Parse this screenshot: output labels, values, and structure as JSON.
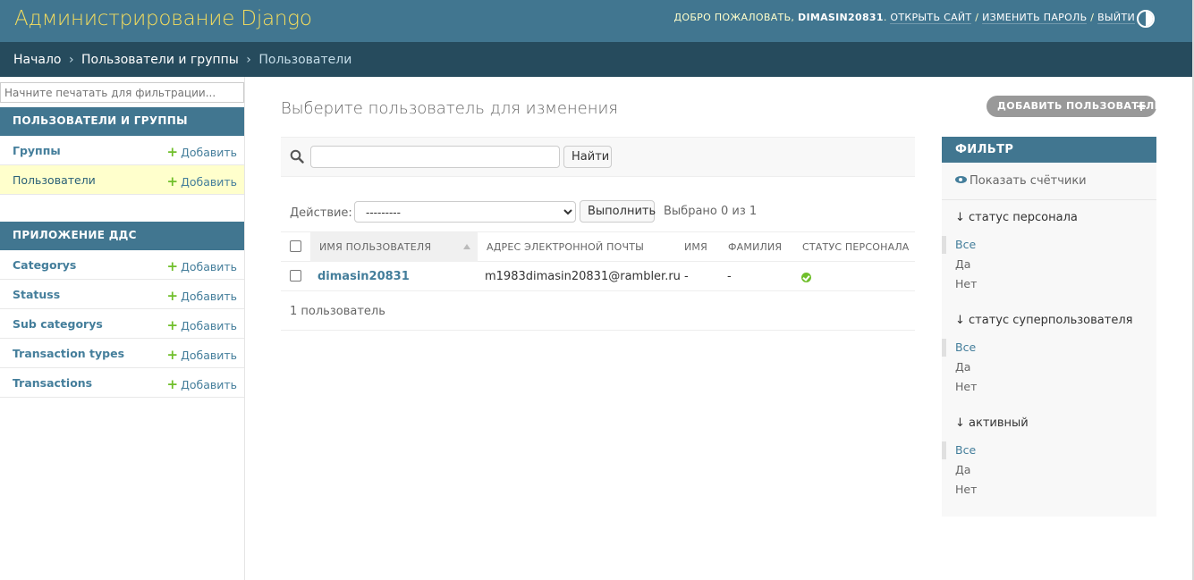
{
  "header": {
    "branding": "Администрирование Django",
    "welcome": "Добро пожаловать,",
    "username": "DIMASIN20831",
    "view_site": "Открыть сайт",
    "change_password": "Изменить пароль",
    "logout": "Выйти",
    "separator": "/",
    "theme_toggle_icon": "contrast-icon"
  },
  "breadcrumbs": {
    "home": "Начало",
    "app": "Пользователи и группы",
    "current": "Пользователи",
    "separator": "›"
  },
  "sidebar": {
    "filter_placeholder": "Начните печатать для фильтрации...",
    "modules": [
      {
        "caption": "Пользователи и группы",
        "models": [
          {
            "name": "Группы",
            "add": "Добавить"
          },
          {
            "name": "Пользователи",
            "add": "Добавить"
          }
        ]
      },
      {
        "caption": "Приложение ДДС",
        "models": [
          {
            "name": "Categorys",
            "add": "Добавить"
          },
          {
            "name": "Statuss",
            "add": "Добавить"
          },
          {
            "name": "Sub categorys",
            "add": "Добавить"
          },
          {
            "name": "Transaction types",
            "add": "Добавить"
          },
          {
            "name": "Transactions",
            "add": "Добавить"
          }
        ]
      }
    ]
  },
  "content": {
    "title": "Выберите пользователь для изменения",
    "add_button": "Добавить пользователь",
    "search_button": "Найти",
    "search_value": "",
    "action_label": "Действие:",
    "action_selected": "---------",
    "action_go": "Выполнить",
    "selection_counter": "Выбрано 0 из 1",
    "columns": [
      "Имя пользователя",
      "Адрес электронной почты",
      "Имя",
      "Фамилия",
      "Статус персонала"
    ],
    "rows": [
      {
        "username": "dimasin20831",
        "email": "m1983dimasin20831@rambler.ru",
        "first_name": "-",
        "last_name": "-",
        "is_staff": true
      }
    ],
    "paginator": "1 пользователь"
  },
  "filter": {
    "title": "Фильтр",
    "show_counts": "Показать счётчики",
    "groups": [
      {
        "heading": "↓ статус персонала",
        "options": [
          "Все",
          "Да",
          "Нет"
        ],
        "selected": 0
      },
      {
        "heading": "↓ статус суперпользователя",
        "options": [
          "Все",
          "Да",
          "Нет"
        ],
        "selected": 0
      },
      {
        "heading": "↓ активный",
        "options": [
          "Все",
          "Да",
          "Нет"
        ],
        "selected": 0
      }
    ]
  },
  "colors": {
    "header_bg": "#417690",
    "breadcrumbs_bg": "#264b5d",
    "branding": "#f5dd5d",
    "link": "#447e9b",
    "add_plus": "#70bf2b",
    "current_row_bg": "#ffffcc"
  }
}
